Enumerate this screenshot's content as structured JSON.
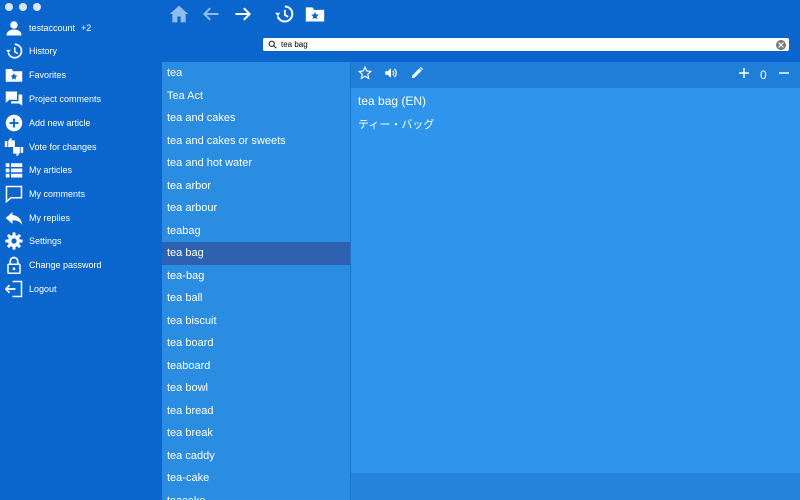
{
  "sidebar": {
    "account": {
      "name": "testaccount",
      "extra": "+2"
    },
    "items": [
      {
        "label": "History",
        "icon": "history-icon"
      },
      {
        "label": "Favorites",
        "icon": "favorites-folder-icon"
      },
      {
        "label": "Project comments",
        "icon": "comments-icon"
      },
      {
        "label": "Add new article",
        "icon": "add-circle-icon"
      },
      {
        "label": "Vote for changes",
        "icon": "vote-icon"
      },
      {
        "label": "My articles",
        "icon": "list-icon"
      },
      {
        "label": "My comments",
        "icon": "comment-icon"
      },
      {
        "label": "My replies",
        "icon": "reply-icon"
      },
      {
        "label": "Settings",
        "icon": "gear-icon"
      },
      {
        "label": "Change password",
        "icon": "lock-icon"
      },
      {
        "label": "Logout",
        "icon": "logout-icon"
      }
    ]
  },
  "toolbar": {
    "icons": [
      "home-icon",
      "back-arrow-icon",
      "forward-arrow-icon",
      "history-icon",
      "favorites-folder-icon"
    ]
  },
  "search": {
    "value": "tea bag"
  },
  "wordlist": {
    "items": [
      "tea",
      "Tea Act",
      "tea and cakes",
      "tea and cakes or sweets",
      "tea and hot water",
      "tea arbor",
      "tea arbour",
      "teabag",
      "tea bag",
      "tea-bag",
      "tea ball",
      "tea biscuit",
      "tea board",
      "teaboard",
      "tea bowl",
      "tea bread",
      "tea break",
      "tea caddy",
      "tea-cake",
      "teacake"
    ],
    "selected": "tea bag"
  },
  "detail": {
    "headword": "tea bag (EN)",
    "translation": "ティー・バッグ",
    "count": "0",
    "icons": [
      "star-icon",
      "speaker-icon",
      "pencil-icon",
      "plus-icon",
      "minus-icon"
    ]
  },
  "colors": {
    "sidebar_bg": "#0a66cc",
    "list_bg": "#2b8de1",
    "selected_row": "#2e62b1",
    "detail_bg": "#2f94ec"
  }
}
